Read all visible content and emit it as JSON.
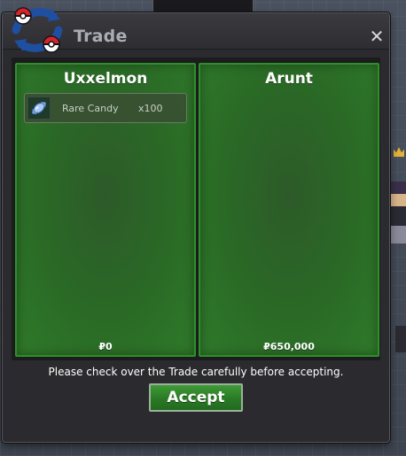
{
  "window": {
    "title": "Trade",
    "close_glyph": "✕"
  },
  "icons": {
    "logo": "trade-pokeball-logo-icon",
    "close": "close-icon",
    "item": "rare-candy-icon"
  },
  "players": [
    {
      "name": "Uxxelmon",
      "items": [
        {
          "name": "Rare Candy",
          "quantity": "x100"
        }
      ],
      "money": "₽0"
    },
    {
      "name": "Arunt",
      "items": [],
      "money": "₽650,000"
    }
  ],
  "notice": "Please check over the Trade carefully before accepting.",
  "accept_label": "Accept",
  "colors": {
    "panel_green": "#2a6a26",
    "panel_border": "#2f8f2a",
    "accept_green": "#2a7a25",
    "pokeball_red": "#d8232a",
    "pokeball_blue": "#1f4fa0"
  }
}
